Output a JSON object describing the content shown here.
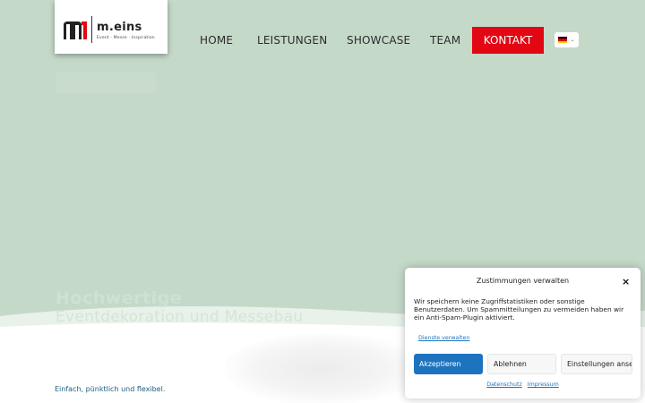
{
  "logo": {
    "name": "m.eins",
    "tagline": "Event · Messe · Inspiration"
  },
  "nav": {
    "items": [
      {
        "label": "HOME"
      },
      {
        "label": "LEISTUNGEN"
      },
      {
        "label": "SHOWCASE"
      },
      {
        "label": "TEAM"
      }
    ],
    "contact": "KONTAKT",
    "language": {
      "icon": "german-flag-icon",
      "caret": "⌄"
    }
  },
  "hero": {
    "title": "Hochwertige",
    "subtitle": "Eventdekoration und Messebau"
  },
  "content": {
    "tagline": "Einfach, pünktlich und flexibel."
  },
  "cookie": {
    "title": "Zustimmungen verwalten",
    "close_icon": "×",
    "text": "Wir speichern keine Zugriffstatistiken oder sonstige Benutzerdaten. Um Spammitteilungen zu vermeiden haben wir ein Anti-Spam-Plugin aktiviert.",
    "manage_link": "Dienste verwalten",
    "accept": "Akzeptieren",
    "deny": "Ablehnen",
    "settings": "Einstellungen ansehen",
    "privacy": "Datenschutz",
    "imprint": "Impressum"
  },
  "colors": {
    "brand_red": "#e30613",
    "accent_blue": "#1e73be",
    "hero_green": "#c5d9c9"
  }
}
